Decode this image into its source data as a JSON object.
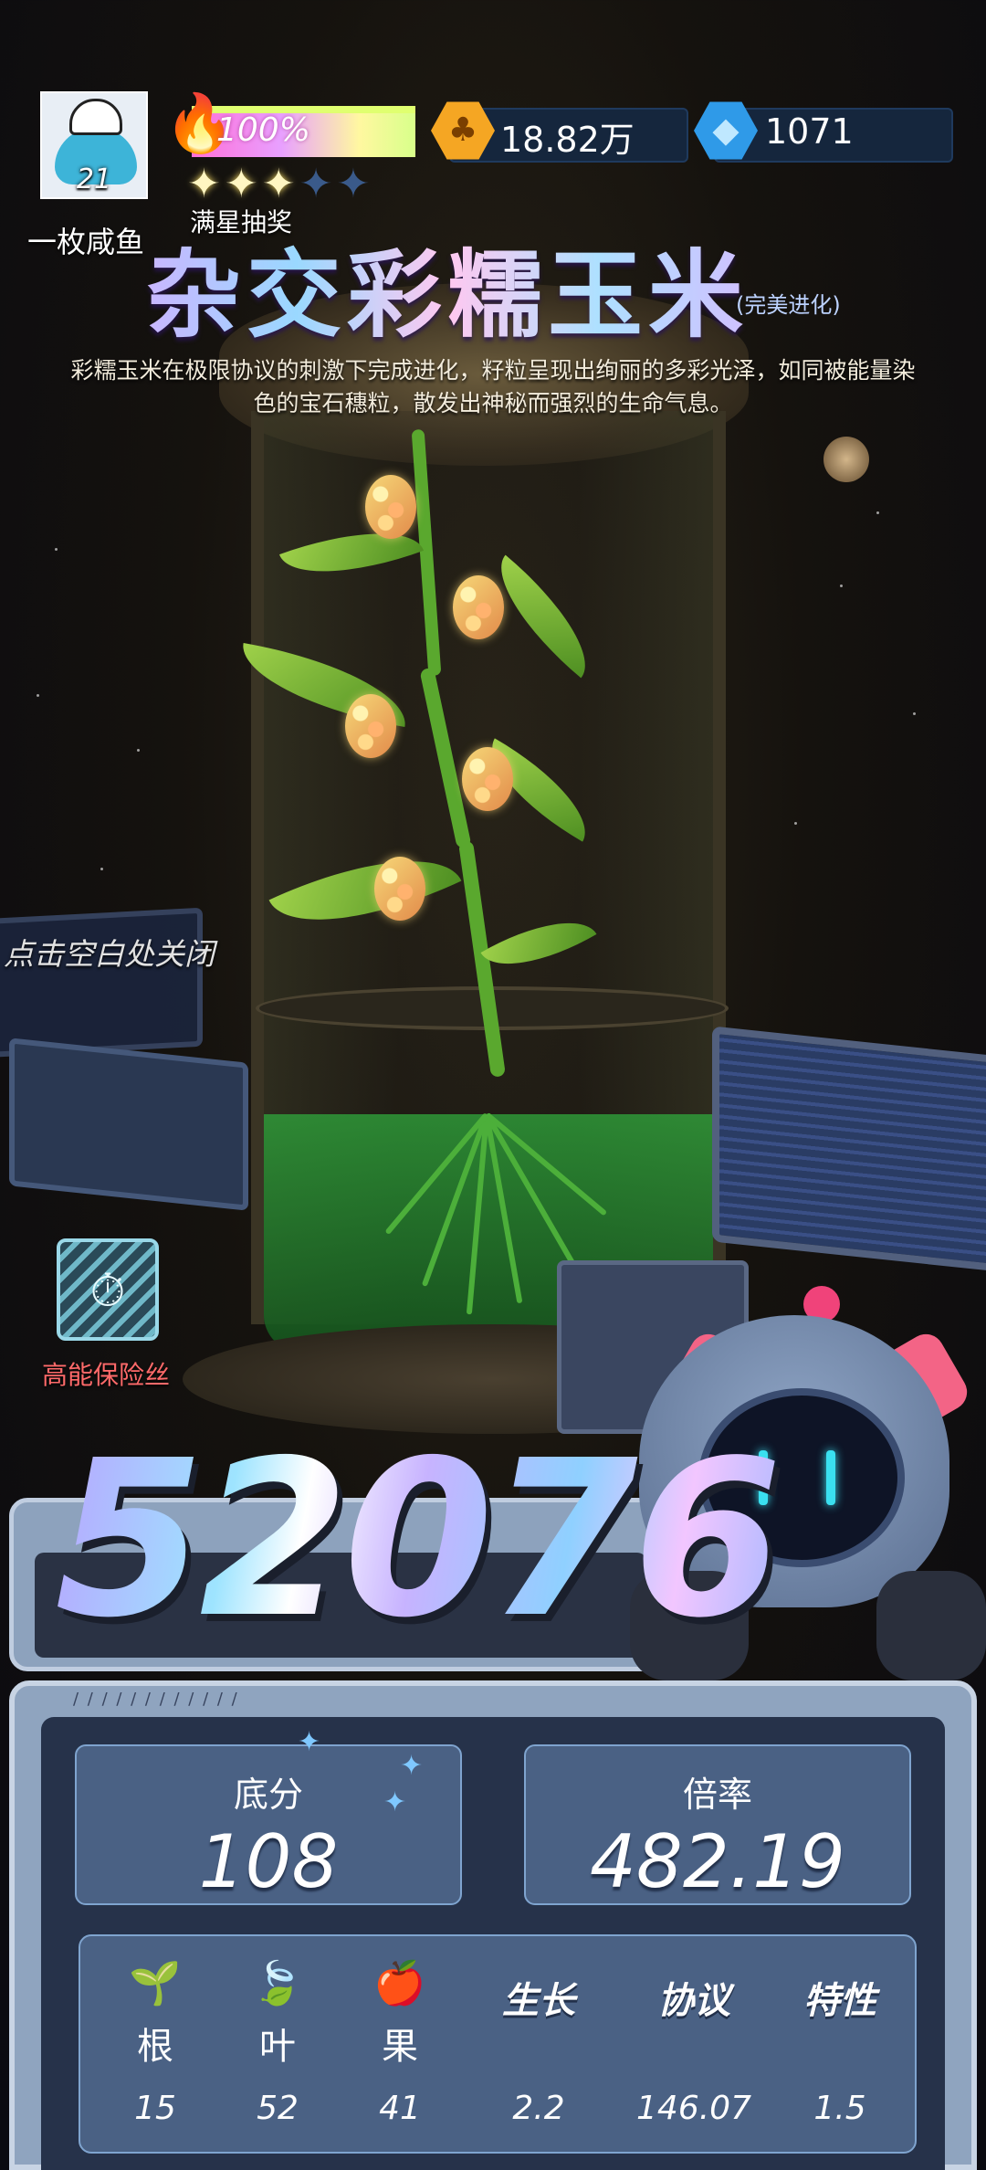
{
  "player": {
    "name": "一枚咸鱼",
    "level": "21",
    "energy_percent": "100%",
    "stars_filled": 3,
    "stars_total": 5,
    "star_reward_label": "满星抽奖"
  },
  "currency": {
    "coins": "18.82万",
    "gems": "1071"
  },
  "item": {
    "title": "杂交彩糯玉米",
    "evolution_tag": "(完美进化)",
    "description": "彩糯玉米在极限协议的刺激下完成进化，籽粒呈现出绚丽的多彩光泽，如同被能量染色的宝石穗粒，散发出神秘而强烈的生命气息。"
  },
  "close_hint": "点击空白处关闭",
  "fuse_label": "高能保险丝",
  "score": "52076",
  "stats": {
    "base_label": "底分",
    "base_value": "108",
    "rate_label": "倍率",
    "rate_value": "482.19"
  },
  "attributes": [
    {
      "name": "根",
      "icon": "sprout-icon",
      "value": "15"
    },
    {
      "name": "叶",
      "icon": "leaf-icon",
      "value": "52"
    },
    {
      "name": "果",
      "icon": "apple-icon",
      "value": "41"
    },
    {
      "name": "生长",
      "value": "2.2"
    },
    {
      "name": "协议",
      "value": "146.07"
    },
    {
      "name": "特性",
      "value": "1.5"
    }
  ],
  "colors": {
    "accent_pink": "#f36486",
    "panel_blue": "#4a6184",
    "fuse_label_red": "#ff6a6a",
    "coin_gold": "#f5a623",
    "gem_blue": "#2f9ae8"
  }
}
